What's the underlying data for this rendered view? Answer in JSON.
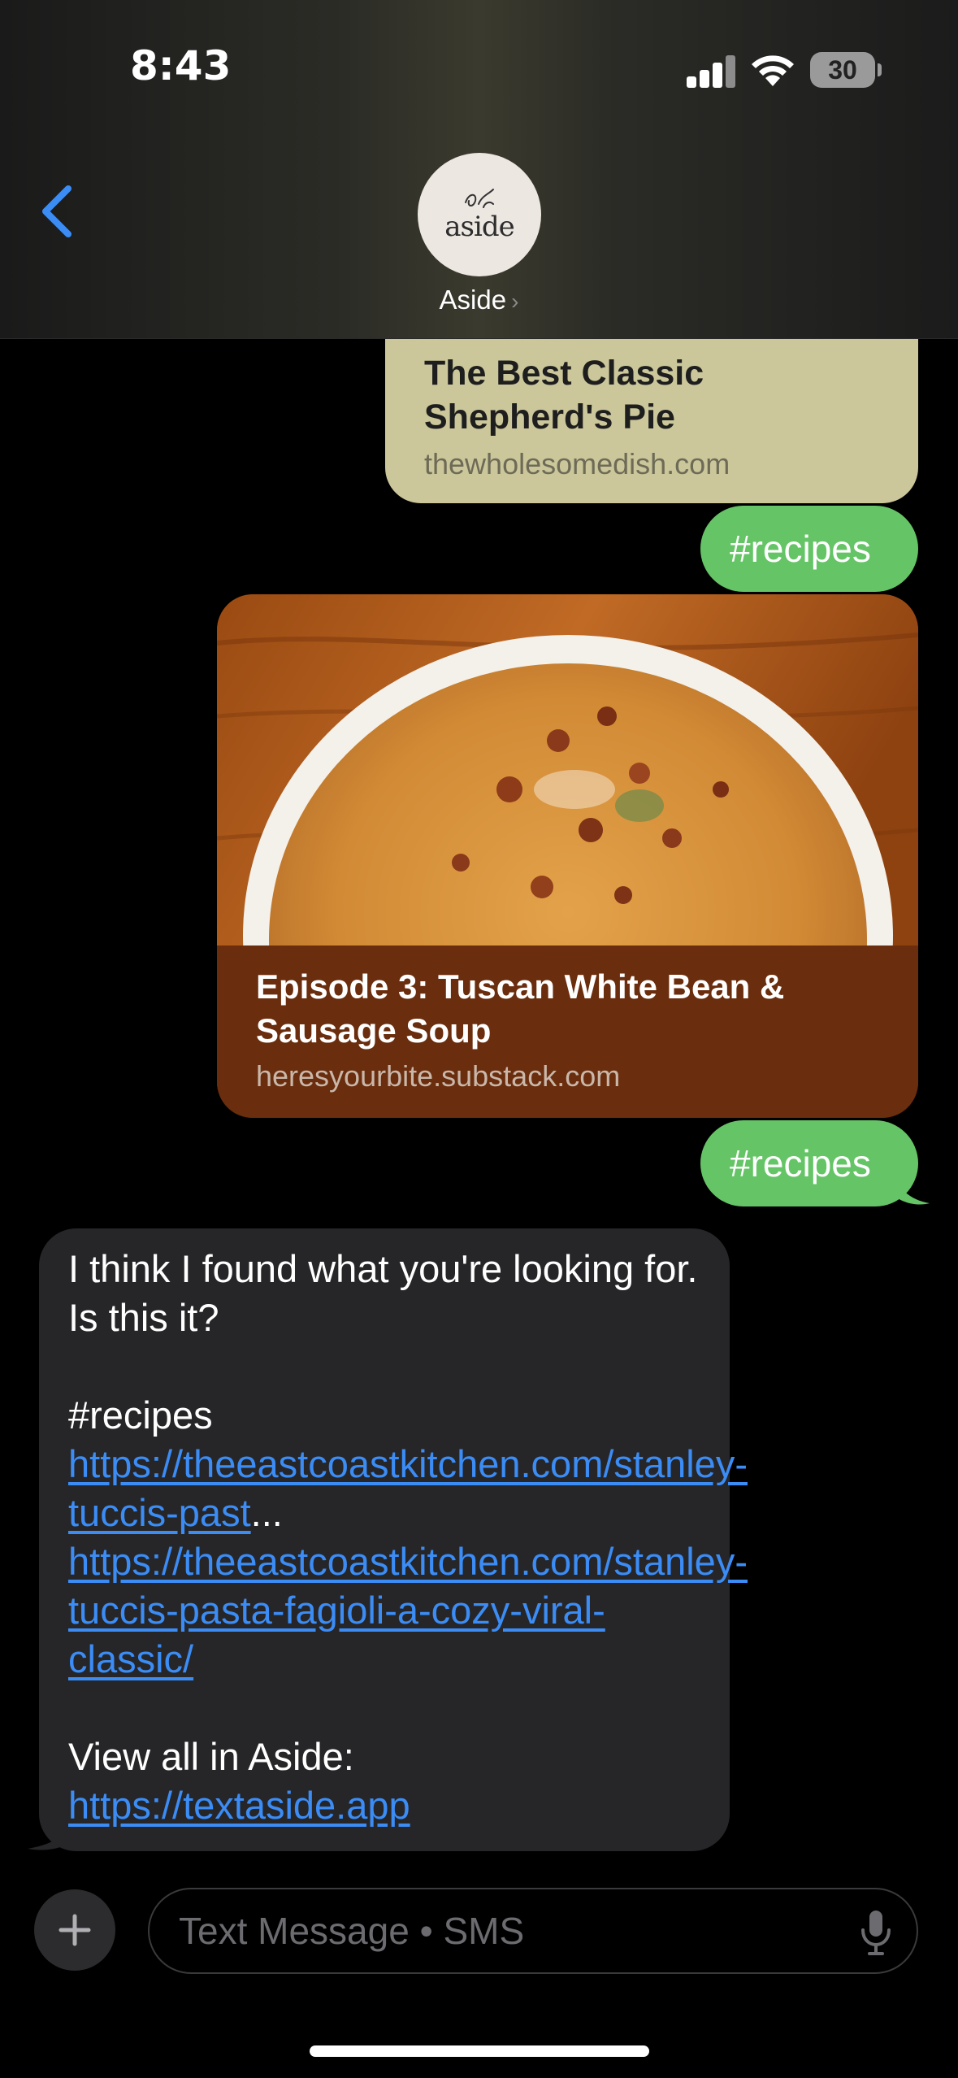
{
  "status_bar": {
    "time": "8:43",
    "battery": "30"
  },
  "header": {
    "contact_name": "Aside",
    "avatar_text": "aside"
  },
  "messages": {
    "card1": {
      "title": "The Best Classic Shepherd's Pie",
      "domain": "thewholesomedish.com"
    },
    "tag1": "#recipes",
    "card2": {
      "title": "Episode 3: Tuscan White Bean & Sausage Soup",
      "domain": "heresyourbite.substack.com"
    },
    "tag2": "#recipes",
    "incoming": {
      "intro": "I think I found what you're looking for. Is this it?",
      "tag": "#recipes ",
      "link_short": "https://theeastcoastkitchen.com/stanley-tuccis-past",
      "ellipsis": "...",
      "link_full": "https://theeastcoastkitchen.com/stanley-tuccis-pasta-fagioli-a-cozy-viral-classic/",
      "view_all": "View all in Aside: ",
      "app_link": "https://textaside.app"
    }
  },
  "composer": {
    "placeholder": "Text Message • SMS"
  },
  "colors": {
    "sent_bubble": "#65c466",
    "received_bubble": "#262628",
    "link": "#3b8cf5",
    "card1_bg": "#cbc79a",
    "card2_bg": "#6a2d0d"
  }
}
